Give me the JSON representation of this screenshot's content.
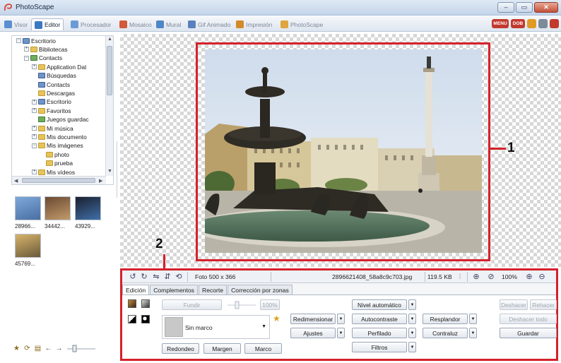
{
  "window": {
    "title": "PhotoScape",
    "buttons": [
      "minimize",
      "maximize",
      "close"
    ]
  },
  "tabs": [
    {
      "label": "Visor",
      "active": false,
      "color": "#5c8ed0"
    },
    {
      "label": "Editor",
      "active": true,
      "color": "#3a7ac4"
    },
    {
      "label": "Procesador",
      "active": false,
      "color": "#6a9bd6"
    },
    {
      "label": "Mosaico",
      "active": false,
      "color": "#d2593a"
    },
    {
      "label": "Mural",
      "active": false,
      "color": "#4f86c6"
    },
    {
      "label": "Gif Animado",
      "active": false,
      "color": "#5a7fbd"
    },
    {
      "label": "Impresión",
      "active": false,
      "color": "#d28a2a"
    },
    {
      "label": "PhotoScape",
      "active": false,
      "color": "#e0a53c"
    }
  ],
  "top_icons": [
    {
      "label": "MENU",
      "color": "#c23a2e"
    },
    {
      "label": "DOB",
      "color": "#c23a2e"
    },
    {
      "label": "",
      "color": "#e19a25"
    },
    {
      "label": "",
      "color": "#7d8a99"
    },
    {
      "label": "",
      "color": "#c23a2e"
    }
  ],
  "tree": [
    {
      "label": "Escritorio",
      "level": 0,
      "expander": "−",
      "icon": "b"
    },
    {
      "label": "Bibliotecas",
      "level": 1,
      "expander": "+",
      "icon": "y"
    },
    {
      "label": "Contacts",
      "level": 1,
      "expander": "−",
      "icon": "g"
    },
    {
      "label": "Application Dat",
      "level": 2,
      "expander": "+",
      "icon": "y"
    },
    {
      "label": "Búsquedas",
      "level": 2,
      "expander": "",
      "icon": "b"
    },
    {
      "label": "Contacts",
      "level": 2,
      "expander": "",
      "icon": "b"
    },
    {
      "label": "Descargas",
      "level": 2,
      "expander": "",
      "icon": "y"
    },
    {
      "label": "Escritorio",
      "level": 2,
      "expander": "+",
      "icon": "b"
    },
    {
      "label": "Favoritos",
      "level": 2,
      "expander": "+",
      "icon": "y"
    },
    {
      "label": "Juegos guardac",
      "level": 2,
      "expander": "",
      "icon": "g"
    },
    {
      "label": "Mi música",
      "level": 2,
      "expander": "+",
      "icon": "y"
    },
    {
      "label": "Mis documento",
      "level": 2,
      "expander": "+",
      "icon": "y"
    },
    {
      "label": "Mis imágenes",
      "level": 2,
      "expander": "−",
      "icon": "y"
    },
    {
      "label": "photo",
      "level": 3,
      "expander": "",
      "icon": "y"
    },
    {
      "label": "prueba",
      "level": 3,
      "expander": "",
      "icon": "y"
    },
    {
      "label": "Mis vídeos",
      "level": 2,
      "expander": "+",
      "icon": "y"
    }
  ],
  "thumbnails": [
    {
      "label": "28966...",
      "colors": [
        "#7fa8d8",
        "#4a6fa3"
      ]
    },
    {
      "label": "34442...",
      "colors": [
        "#6b4a32",
        "#c29a6a"
      ]
    },
    {
      "label": "43929...",
      "colors": [
        "#1b2030",
        "#3f6fa8"
      ]
    },
    {
      "label": "45769...",
      "colors": [
        "#d7b36b",
        "#6a5a3a"
      ]
    }
  ],
  "callouts": {
    "photo": "1",
    "editor": "2"
  },
  "status": {
    "size": "Foto 500 x 366",
    "filename": "2896621408_58a8c9c703.jpg",
    "filesize": "119.5 KB",
    "zoom": "100%"
  },
  "subtabs": [
    {
      "label": "Edición",
      "active": true
    },
    {
      "label": "Complementos",
      "active": false
    },
    {
      "label": "Recorte",
      "active": false
    },
    {
      "label": "Corrección por zonas",
      "active": false
    }
  ],
  "edit": {
    "fundir": "Fundir",
    "fundir_value": "100%",
    "frame_value": "Sin marco",
    "redondeo": "Redondeo",
    "margen": "Margen",
    "marco": "Marco",
    "redimensionar": "Redimensionar",
    "ajustes": "Ajustes",
    "nivel": "Nivel automático",
    "autocontraste": "Autocontraste",
    "perfilado": "Perfilado",
    "filtros": "Filtros",
    "resplandor": "Resplandor",
    "contraluz": "Contraluz",
    "deshacer": "Deshacer",
    "rehacer": "Rehacer",
    "deshacer_todo": "Deshacer todo",
    "guardar": "Guardar"
  }
}
